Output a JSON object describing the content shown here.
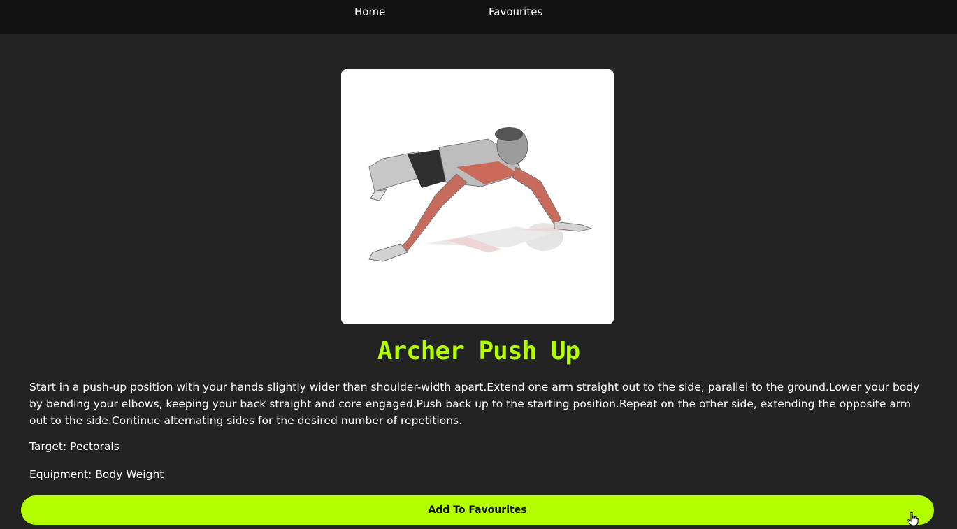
{
  "nav": {
    "home": "Home",
    "favourites": "Favourites"
  },
  "exercise": {
    "name": "Archer Push Up",
    "image_subject": "archer-push-up-illustration",
    "description": "Start in a push-up position with your hands slightly wider than shoulder-width apart.Extend one arm straight out to the side, parallel to the ground.Lower your body by bending your elbows, keeping your back straight and core engaged.Push back up to the starting position.Repeat on the other side, extending the opposite arm out to the side.Continue alternating sides for the desired number of repetitions.",
    "target_text": "Target: Pectorals",
    "equipment_text": "Equipment: Body Weight"
  },
  "actions": {
    "add_favourite": "Add To Favourites"
  },
  "colors": {
    "background": "#232323",
    "navbar": "#121212",
    "accent": "#b3ff00"
  },
  "icons": {
    "cursor": "hand-pointer-icon"
  }
}
